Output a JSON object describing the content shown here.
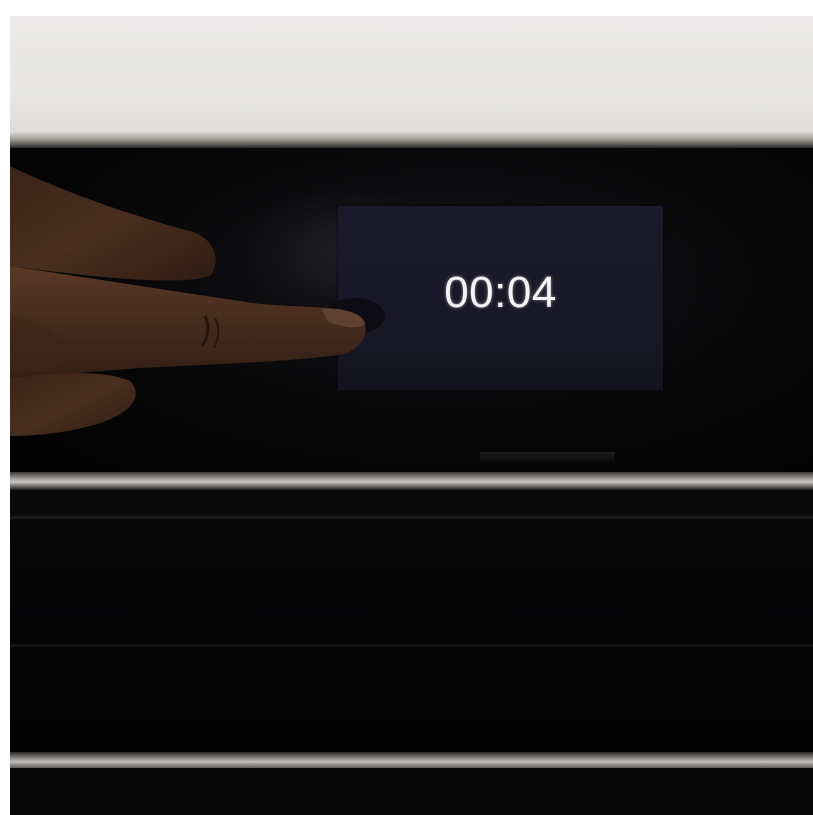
{
  "display": {
    "timer_text": "00:04"
  }
}
